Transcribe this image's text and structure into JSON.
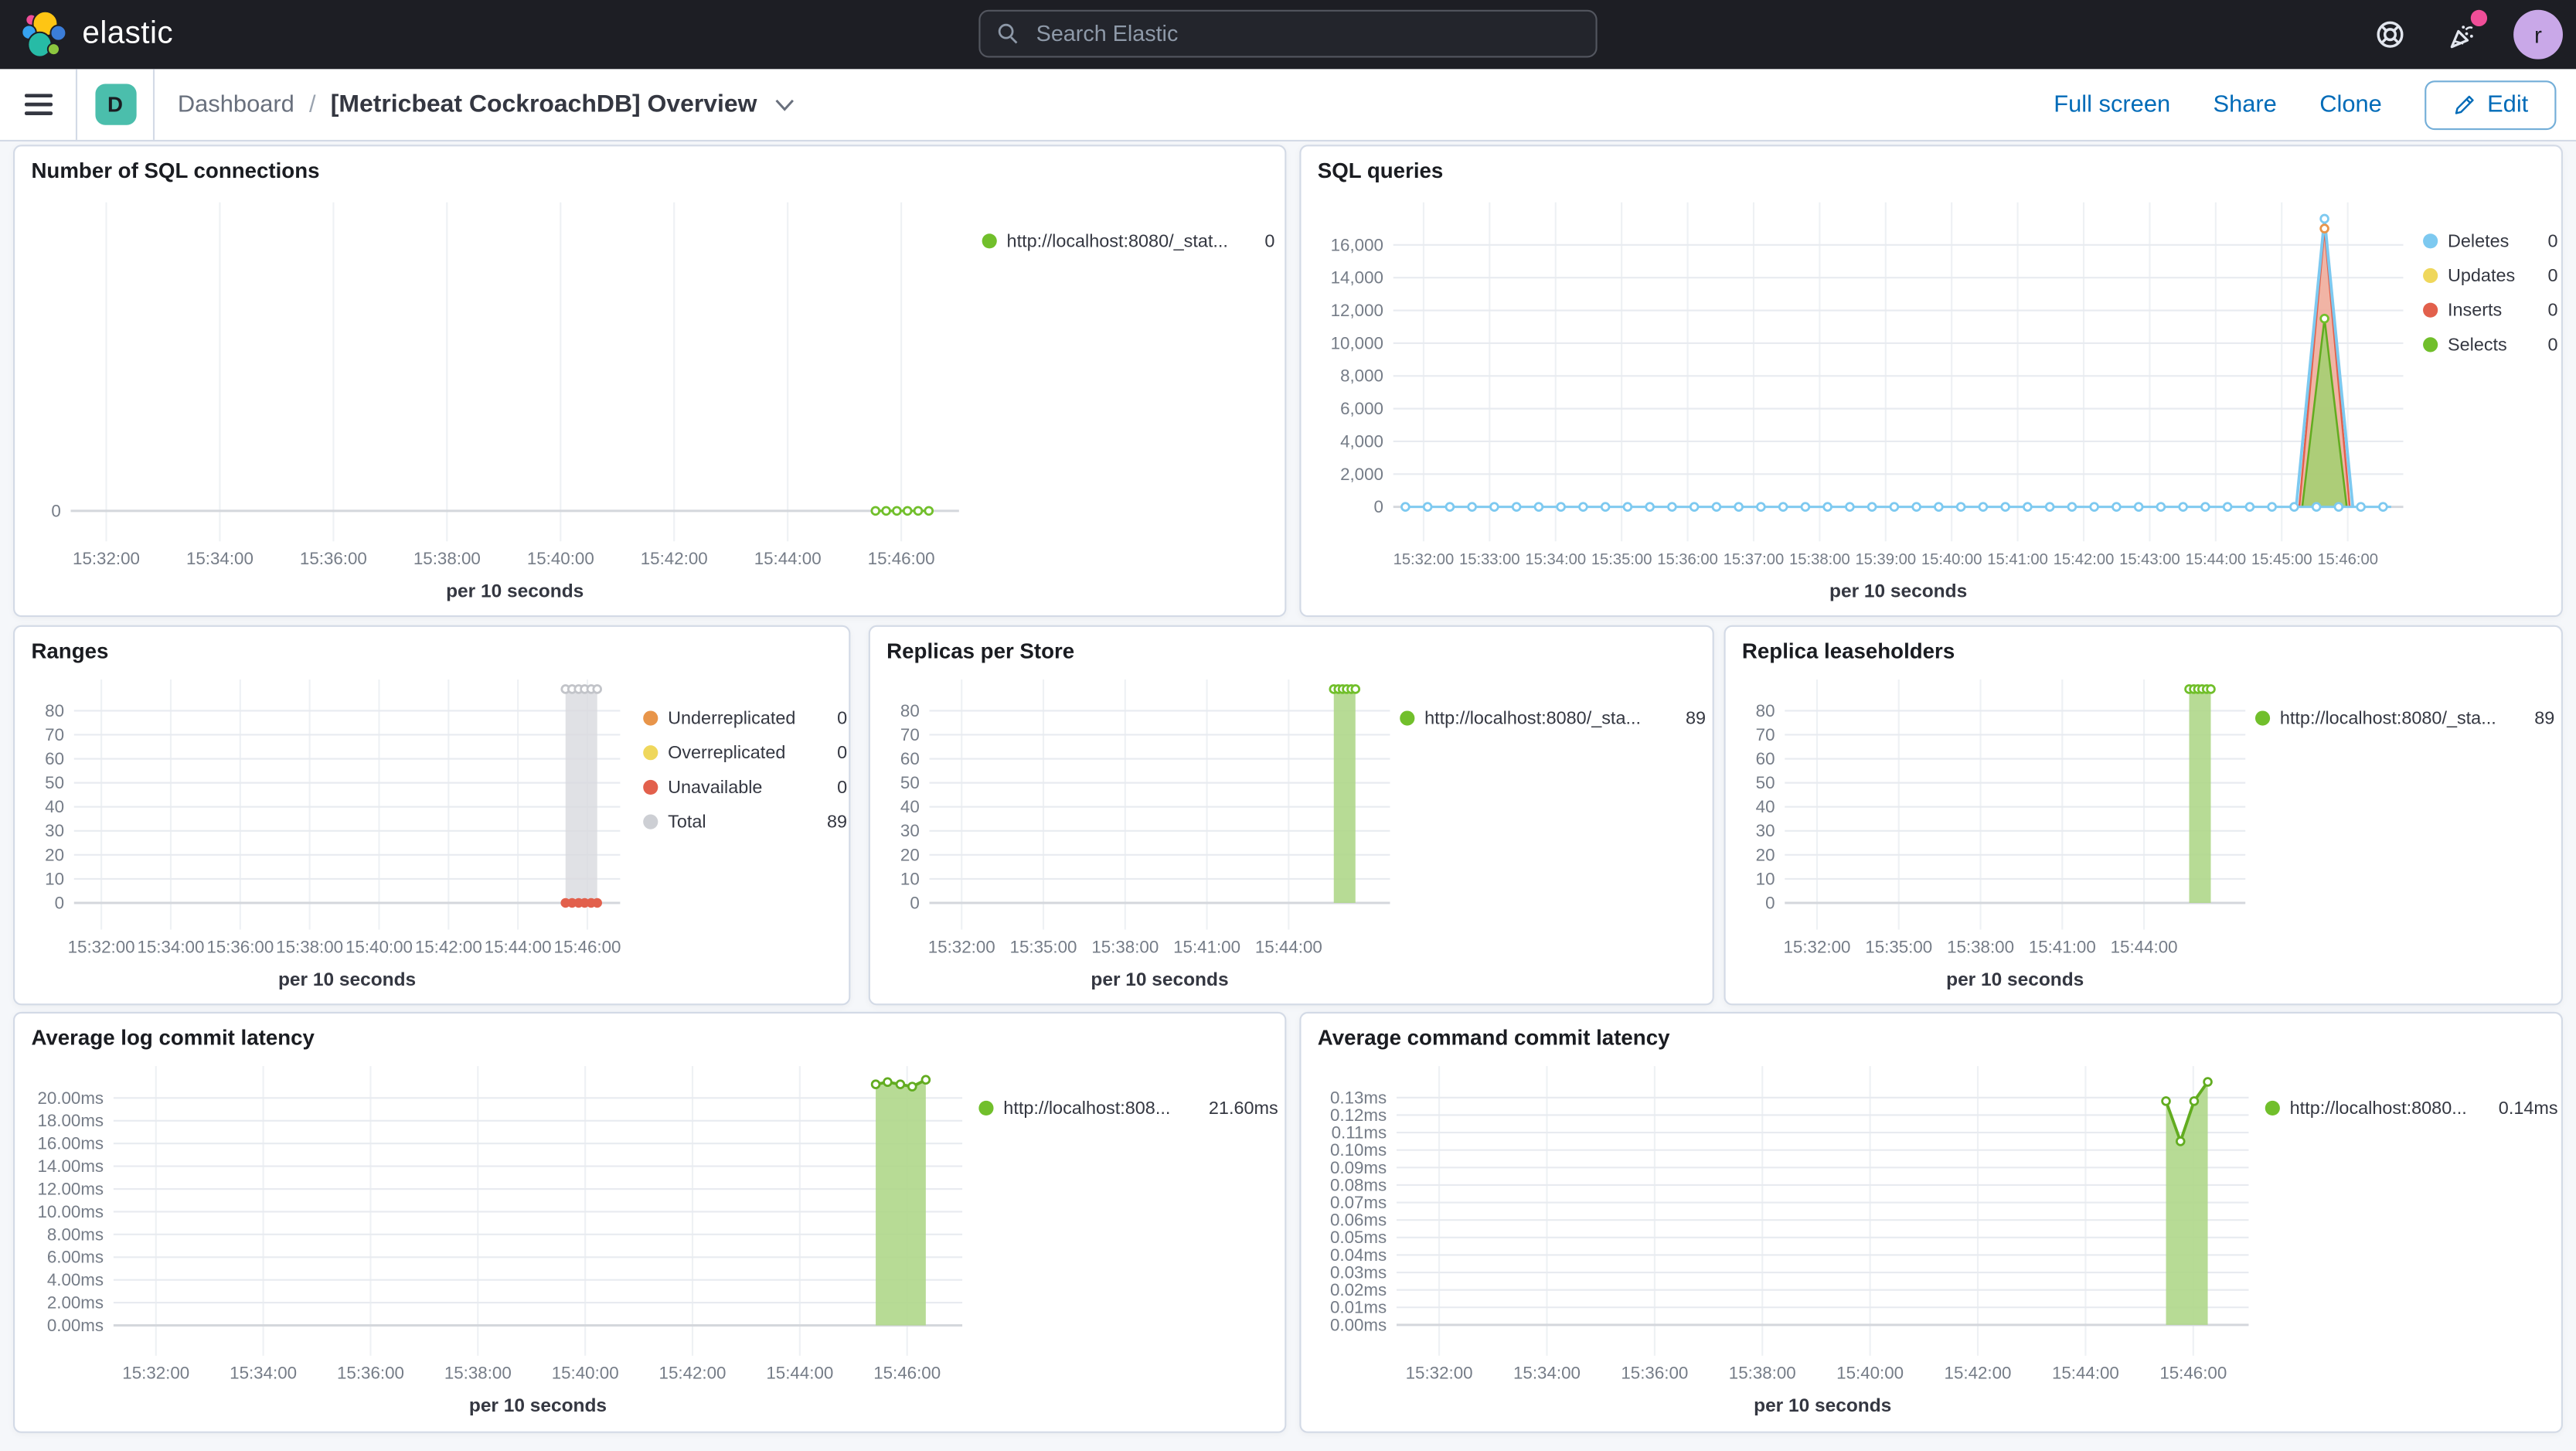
{
  "header": {
    "brand": "elastic",
    "search_placeholder": "Search Elastic",
    "avatar_initial": "r"
  },
  "navbar": {
    "space_initial": "D",
    "breadcrumb_root": "Dashboard",
    "breadcrumb_separator": "/",
    "breadcrumb_current": "[Metricbeat CockroachDB] Overview",
    "actions": {
      "full_screen": "Full screen",
      "share": "Share",
      "clone": "Clone",
      "edit": "Edit"
    }
  },
  "colors": {
    "green_dot": "#71BF2B",
    "green_line": "#62AC20",
    "green_fill": "#AFD78A",
    "blue": "#7DC9F0",
    "yellow": "#EFD75C",
    "red": "#E2604C",
    "orange": "#E8954A",
    "gray_dot": "#CDCFD4",
    "gray_fill": "#D8DADE",
    "accent_blue": "#006BB8",
    "pink": "#F04E98",
    "teal": "#4BBEAC"
  },
  "chart_data": {
    "conn": {
      "type": "line",
      "title": "Number of SQL connections",
      "x_title": "per 10 seconds",
      "y_ticks": [
        {
          "v": 0,
          "l": "0"
        }
      ],
      "x_ticks": [
        "15:32:00",
        "15:34:00",
        "15:36:00",
        "15:38:00",
        "15:40:00",
        "15:42:00",
        "15:44:00",
        "15:46:00"
      ],
      "legend": [
        {
          "label": "http://localhost:8080/_stat...",
          "value": "0",
          "color": "#71BF2B"
        }
      ],
      "series": [
        {
          "type": "line",
          "color": "#71BF2B",
          "width": 1.5,
          "points": [
            [
              0.906,
              0
            ],
            [
              0.918,
              0
            ],
            [
              0.93,
              0
            ],
            [
              0.942,
              0
            ],
            [
              0.954,
              0
            ],
            [
              0.966,
              0
            ]
          ],
          "markers": "open"
        }
      ]
    },
    "queries": {
      "type": "area",
      "title": "SQL queries",
      "x_title": "per 10 seconds",
      "y_ticks": [
        {
          "v": 0,
          "l": "0"
        },
        {
          "v": 2000,
          "l": "2,000"
        },
        {
          "v": 4000,
          "l": "4,000"
        },
        {
          "v": 6000,
          "l": "6,000"
        },
        {
          "v": 8000,
          "l": "8,000"
        },
        {
          "v": 10000,
          "l": "10,000"
        },
        {
          "v": 12000,
          "l": "12,000"
        },
        {
          "v": 14000,
          "l": "14,000"
        },
        {
          "v": 16000,
          "l": "16,000"
        }
      ],
      "x_ticks": [
        "15:32:00",
        "15:33:00",
        "15:34:00",
        "15:35:00",
        "15:36:00",
        "15:37:00",
        "15:38:00",
        "15:39:00",
        "15:40:00",
        "15:41:00",
        "15:42:00",
        "15:43:00",
        "15:44:00",
        "15:45:00",
        "15:46:00"
      ],
      "legend": [
        {
          "label": "Deletes",
          "value": "0",
          "color": "#7DC9F0"
        },
        {
          "label": "Updates",
          "value": "0",
          "color": "#EFD75C"
        },
        {
          "label": "Inserts",
          "value": "0",
          "color": "#E2604C"
        },
        {
          "label": "Selects",
          "value": "0",
          "color": "#71BF2B"
        }
      ],
      "series": [
        {
          "type": "area",
          "color": "#E2604C",
          "fill": "#EFA795",
          "opacity": 0.85,
          "width": 1.2,
          "points": [
            [
              0.897,
              0
            ],
            [
              0.922,
              17000
            ],
            [
              0.947,
              0
            ]
          ]
        },
        {
          "type": "area",
          "color": "#62AC20",
          "fill": "#A5CF73",
          "opacity": 0.9,
          "width": 1.2,
          "points": [
            [
              0.9,
              0
            ],
            [
              0.922,
              11500
            ],
            [
              0.944,
              0
            ]
          ]
        },
        {
          "type": "line",
          "color": "#7DC9F0",
          "width": 1.8,
          "points": [
            [
              0.894,
              0
            ],
            [
              0.922,
              17600
            ],
            [
              0.95,
              0
            ]
          ]
        },
        {
          "type": "linemarkers",
          "color": "#7DC9F0",
          "width": 1.3,
          "y": 0,
          "from": 0.012,
          "to": 0.988,
          "step": 0.022
        },
        {
          "type": "markers",
          "style": "open",
          "color": "#E8954A",
          "points": [
            [
              0.922,
              17000
            ]
          ]
        },
        {
          "type": "markers",
          "style": "open",
          "color": "#7DC9F0",
          "points": [
            [
              0.922,
              17600
            ]
          ]
        },
        {
          "type": "markers",
          "style": "open",
          "color": "#71BF2B",
          "points": [
            [
              0.922,
              11500
            ]
          ]
        }
      ]
    },
    "ranges": {
      "type": "area",
      "title": "Ranges",
      "x_title": "per 10 seconds",
      "y_ticks": [
        {
          "v": 0,
          "l": "0"
        },
        {
          "v": 10,
          "l": "10"
        },
        {
          "v": 20,
          "l": "20"
        },
        {
          "v": 30,
          "l": "30"
        },
        {
          "v": 40,
          "l": "40"
        },
        {
          "v": 50,
          "l": "50"
        },
        {
          "v": 60,
          "l": "60"
        },
        {
          "v": 70,
          "l": "70"
        },
        {
          "v": 80,
          "l": "80"
        }
      ],
      "x_ticks": [
        "15:32:00",
        "15:34:00",
        "15:36:00",
        "15:38:00",
        "15:40:00",
        "15:42:00",
        "15:44:00",
        "15:46:00"
      ],
      "legend": [
        {
          "label": "Underreplicated",
          "value": "0",
          "color": "#E8954A"
        },
        {
          "label": "Overreplicated",
          "value": "0",
          "color": "#EFD75C"
        },
        {
          "label": "Unavailable",
          "value": "0",
          "color": "#E2604C"
        },
        {
          "label": "Total",
          "value": "89",
          "color": "#CDCFD4"
        }
      ],
      "series": [
        {
          "type": "area",
          "color": "#C9CBD0",
          "fill": "#D8DADE",
          "opacity": 0.8,
          "width": 1,
          "points": [
            [
              0.9,
              89
            ],
            [
              0.958,
              89
            ]
          ]
        },
        {
          "type": "markers",
          "style": "open",
          "color": "#C2C4C9",
          "points": [
            [
              0.9,
              89
            ],
            [
              0.912,
              89
            ],
            [
              0.924,
              89
            ],
            [
              0.935,
              89
            ],
            [
              0.947,
              89
            ],
            [
              0.958,
              89
            ]
          ]
        },
        {
          "type": "markers",
          "style": "filled",
          "color": "#E2604C",
          "points": [
            [
              0.9,
              0
            ],
            [
              0.912,
              0
            ],
            [
              0.924,
              0
            ],
            [
              0.935,
              0
            ],
            [
              0.947,
              0
            ],
            [
              0.958,
              0
            ]
          ]
        }
      ]
    },
    "replicas": {
      "type": "area",
      "title": "Replicas per Store",
      "x_title": "per 10 seconds",
      "y_ticks": [
        {
          "v": 0,
          "l": "0"
        },
        {
          "v": 10,
          "l": "10"
        },
        {
          "v": 20,
          "l": "20"
        },
        {
          "v": 30,
          "l": "30"
        },
        {
          "v": 40,
          "l": "40"
        },
        {
          "v": 50,
          "l": "50"
        },
        {
          "v": 60,
          "l": "60"
        },
        {
          "v": 70,
          "l": "70"
        },
        {
          "v": 80,
          "l": "80"
        }
      ],
      "x_ticks": [
        "15:32:00",
        "15:35:00",
        "15:38:00",
        "15:41:00",
        "15:44:00"
      ],
      "legend": [
        {
          "label": "http://localhost:8080/_sta...",
          "value": "89",
          "color": "#71BF2B"
        }
      ],
      "series": [
        {
          "type": "area",
          "color": "#8CC35A",
          "fill": "#AFD78A",
          "opacity": 0.9,
          "width": 1,
          "points": [
            [
              0.878,
              89
            ],
            [
              0.925,
              89
            ]
          ]
        },
        {
          "type": "markers",
          "style": "open",
          "color": "#71BF2B",
          "points": [
            [
              0.878,
              89
            ],
            [
              0.888,
              89
            ],
            [
              0.897,
              89
            ],
            [
              0.906,
              89
            ],
            [
              0.916,
              89
            ],
            [
              0.925,
              89
            ]
          ]
        }
      ]
    },
    "leaseholders": {
      "type": "area",
      "title": "Replica leaseholders",
      "x_title": "per 10 seconds",
      "y_ticks": [
        {
          "v": 0,
          "l": "0"
        },
        {
          "v": 10,
          "l": "10"
        },
        {
          "v": 20,
          "l": "20"
        },
        {
          "v": 30,
          "l": "30"
        },
        {
          "v": 40,
          "l": "40"
        },
        {
          "v": 50,
          "l": "50"
        },
        {
          "v": 60,
          "l": "60"
        },
        {
          "v": 70,
          "l": "70"
        },
        {
          "v": 80,
          "l": "80"
        }
      ],
      "x_ticks": [
        "15:32:00",
        "15:35:00",
        "15:38:00",
        "15:41:00",
        "15:44:00"
      ],
      "legend": [
        {
          "label": "http://localhost:8080/_sta...",
          "value": "89",
          "color": "#71BF2B"
        }
      ],
      "series": [
        {
          "type": "area",
          "color": "#8CC35A",
          "fill": "#AFD78A",
          "opacity": 0.9,
          "width": 1,
          "points": [
            [
              0.878,
              89
            ],
            [
              0.925,
              89
            ]
          ]
        },
        {
          "type": "markers",
          "style": "open",
          "color": "#71BF2B",
          "points": [
            [
              0.878,
              89
            ],
            [
              0.888,
              89
            ],
            [
              0.897,
              89
            ],
            [
              0.906,
              89
            ],
            [
              0.916,
              89
            ],
            [
              0.925,
              89
            ]
          ]
        }
      ]
    },
    "loglat": {
      "type": "area",
      "title": "Average log commit latency",
      "x_title": "per 10 seconds",
      "y_ticks": [
        {
          "v": 0,
          "l": "0.00ms"
        },
        {
          "v": 2,
          "l": "2.00ms"
        },
        {
          "v": 4,
          "l": "4.00ms"
        },
        {
          "v": 6,
          "l": "6.00ms"
        },
        {
          "v": 8,
          "l": "8.00ms"
        },
        {
          "v": 10,
          "l": "10.00ms"
        },
        {
          "v": 12,
          "l": "12.00ms"
        },
        {
          "v": 14,
          "l": "14.00ms"
        },
        {
          "v": 16,
          "l": "16.00ms"
        },
        {
          "v": 18,
          "l": "18.00ms"
        },
        {
          "v": 20,
          "l": "20.00ms"
        }
      ],
      "x_ticks": [
        "15:32:00",
        "15:34:00",
        "15:36:00",
        "15:38:00",
        "15:40:00",
        "15:42:00",
        "15:44:00",
        "15:46:00"
      ],
      "legend": [
        {
          "label": "http://localhost:808...",
          "value": "21.60ms",
          "color": "#71BF2B"
        }
      ],
      "series": [
        {
          "type": "area",
          "color": "#62AC20",
          "fill": "#AFD78A",
          "opacity": 0.9,
          "width": 1.8,
          "points": [
            [
              0.898,
              21.2
            ],
            [
              0.912,
              21.4
            ],
            [
              0.927,
              21.2
            ],
            [
              0.941,
              21.0
            ],
            [
              0.957,
              21.6
            ]
          ],
          "markers": "open"
        }
      ]
    },
    "cmdlat": {
      "type": "area",
      "title": "Average command commit latency",
      "x_title": "per 10 seconds",
      "y_ticks": [
        {
          "v": 0,
          "l": "0.00ms"
        },
        {
          "v": 0.01,
          "l": "0.01ms"
        },
        {
          "v": 0.02,
          "l": "0.02ms"
        },
        {
          "v": 0.03,
          "l": "0.03ms"
        },
        {
          "v": 0.04,
          "l": "0.04ms"
        },
        {
          "v": 0.05,
          "l": "0.05ms"
        },
        {
          "v": 0.06,
          "l": "0.06ms"
        },
        {
          "v": 0.07,
          "l": "0.07ms"
        },
        {
          "v": 0.08,
          "l": "0.08ms"
        },
        {
          "v": 0.09,
          "l": "0.09ms"
        },
        {
          "v": 0.1,
          "l": "0.10ms"
        },
        {
          "v": 0.11,
          "l": "0.11ms"
        },
        {
          "v": 0.12,
          "l": "0.12ms"
        },
        {
          "v": 0.13,
          "l": "0.13ms"
        }
      ],
      "x_ticks": [
        "15:32:00",
        "15:34:00",
        "15:36:00",
        "15:38:00",
        "15:40:00",
        "15:42:00",
        "15:44:00",
        "15:46:00"
      ],
      "legend": [
        {
          "label": "http://localhost:8080...",
          "value": "0.14ms",
          "color": "#71BF2B"
        }
      ],
      "series": [
        {
          "type": "area",
          "color": "#62AC20",
          "fill": "#AFD78A",
          "opacity": 0.9,
          "width": 1.8,
          "points": [
            [
              0.903,
              0.128
            ],
            [
              0.92,
              0.105
            ],
            [
              0.936,
              0.128
            ],
            [
              0.952,
              0.139
            ]
          ],
          "markers": "open"
        }
      ]
    }
  }
}
